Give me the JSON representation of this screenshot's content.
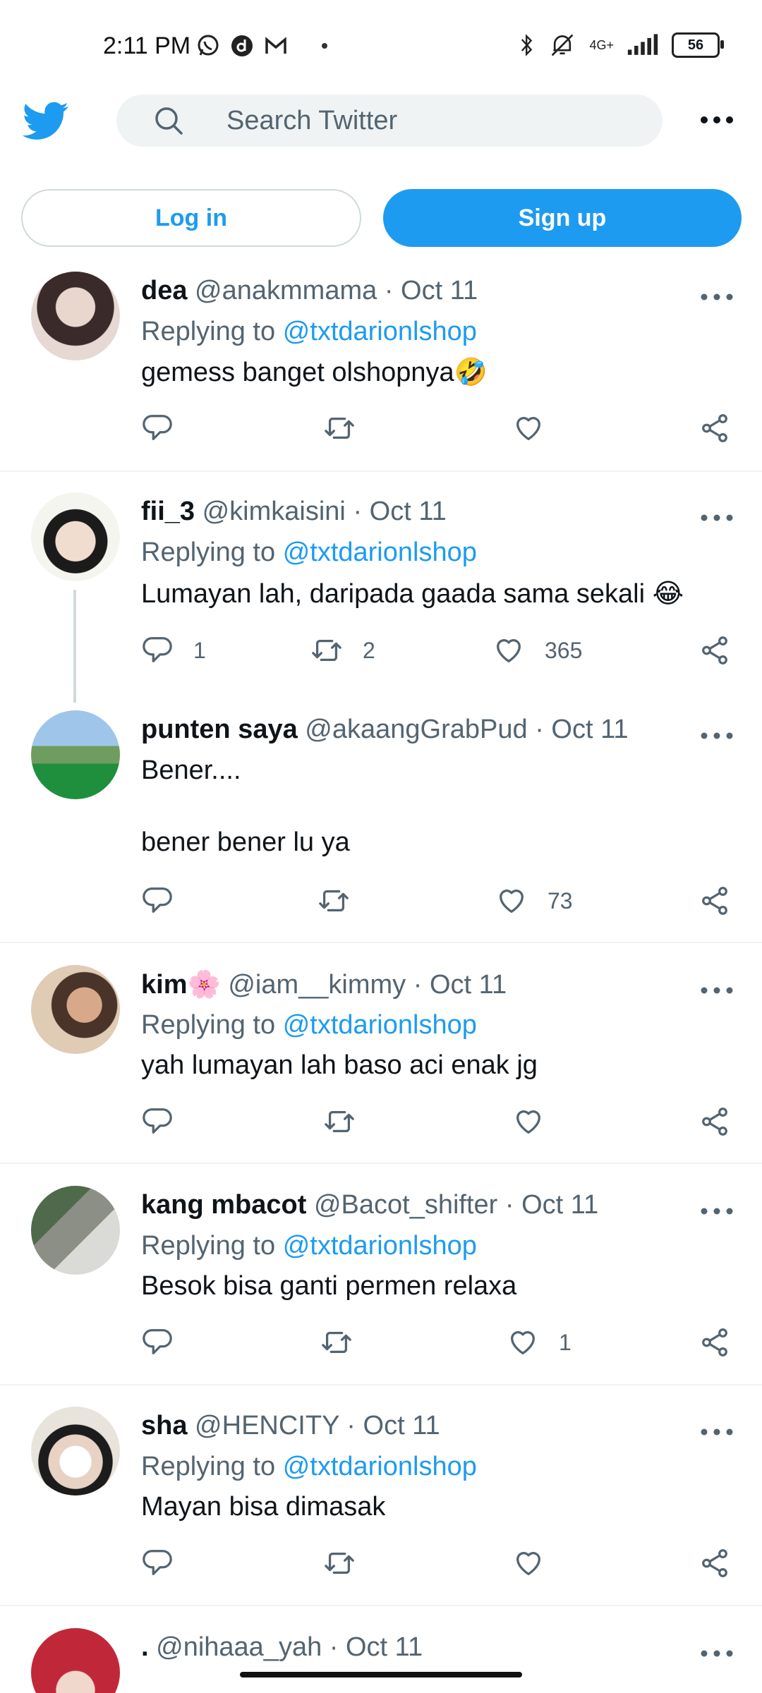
{
  "status_bar": {
    "time": "2:11 PM",
    "network": "4G+",
    "battery": "56",
    "icons_left": [
      "whatsapp-icon",
      "app-d-icon",
      "gmail-icon",
      "dot-icon"
    ],
    "icons_right": [
      "bluetooth-icon",
      "mute-icon",
      "signal-icon",
      "battery-icon"
    ]
  },
  "header": {
    "search_placeholder": "Search Twitter"
  },
  "auth": {
    "login_label": "Log in",
    "signup_label": "Sign up"
  },
  "colors": {
    "accent": "#1d9bf0",
    "secondary_text": "#536471",
    "divider": "#eff3f4"
  },
  "tweets": [
    {
      "name": "dea",
      "handle": "@anakmmama",
      "date": "Oct 11",
      "replying_prefix": "Replying to",
      "replying_to": "@txtdarionlshop",
      "text": "gemess banget olshopnya🤣",
      "replies": "",
      "retweets": "",
      "likes": ""
    },
    {
      "name": "fii_3",
      "handle": "@kimkaisini",
      "date": "Oct 11",
      "replying_prefix": "Replying to",
      "replying_to": "@txtdarionlshop",
      "text": "Lumayan lah, daripada gaada sama sekali 😂",
      "replies": "1",
      "retweets": "2",
      "likes": "365"
    },
    {
      "name": "punten saya",
      "handle": "@akaangGrabPud",
      "date": "Oct 11",
      "text_line1": "Bener....",
      "text_line2": "bener bener lu ya",
      "replies": "",
      "retweets": "",
      "likes": "73"
    },
    {
      "name": "kim🌸",
      "handle": "@iam__kimmy",
      "date": "Oct 11",
      "replying_prefix": "Replying to",
      "replying_to": "@txtdarionlshop",
      "text": "yah lumayan lah baso aci enak jg",
      "replies": "",
      "retweets": "",
      "likes": ""
    },
    {
      "name": "kang mbacot",
      "handle": "@Bacot_shifter",
      "date": "Oct 11",
      "replying_prefix": "Replying to",
      "replying_to": "@txtdarionlshop",
      "text": "Besok bisa ganti permen relaxa",
      "replies": "",
      "retweets": "",
      "likes": "1"
    },
    {
      "name": "sha",
      "handle": "@HENCITY",
      "date": "Oct 11",
      "replying_prefix": "Replying to",
      "replying_to": "@txtdarionlshop",
      "text": "Mayan bisa dimasak",
      "replies": "",
      "retweets": "",
      "likes": ""
    },
    {
      "name": ".",
      "handle": "@nihaaa_yah",
      "date": "Oct 11"
    }
  ],
  "separator": "·"
}
